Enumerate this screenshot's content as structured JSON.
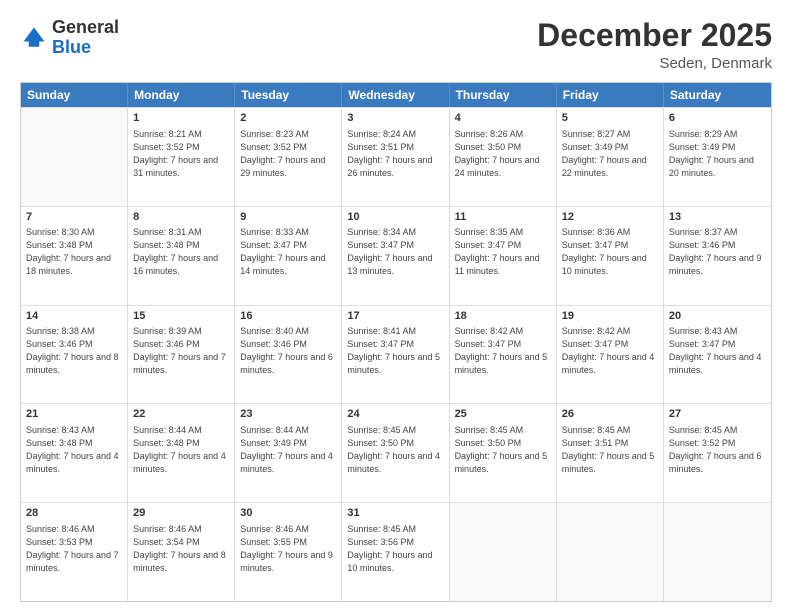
{
  "logo": {
    "general": "General",
    "blue": "Blue"
  },
  "header": {
    "title": "December 2025",
    "subtitle": "Seden, Denmark"
  },
  "calendar": {
    "days": [
      "Sunday",
      "Monday",
      "Tuesday",
      "Wednesday",
      "Thursday",
      "Friday",
      "Saturday"
    ],
    "rows": [
      [
        {
          "day": "",
          "empty": true
        },
        {
          "day": "1",
          "sunrise": "8:21 AM",
          "sunset": "3:52 PM",
          "daylight": "7 hours and 31 minutes."
        },
        {
          "day": "2",
          "sunrise": "8:23 AM",
          "sunset": "3:52 PM",
          "daylight": "7 hours and 29 minutes."
        },
        {
          "day": "3",
          "sunrise": "8:24 AM",
          "sunset": "3:51 PM",
          "daylight": "7 hours and 26 minutes."
        },
        {
          "day": "4",
          "sunrise": "8:26 AM",
          "sunset": "3:50 PM",
          "daylight": "7 hours and 24 minutes."
        },
        {
          "day": "5",
          "sunrise": "8:27 AM",
          "sunset": "3:49 PM",
          "daylight": "7 hours and 22 minutes."
        },
        {
          "day": "6",
          "sunrise": "8:29 AM",
          "sunset": "3:49 PM",
          "daylight": "7 hours and 20 minutes."
        }
      ],
      [
        {
          "day": "7",
          "sunrise": "8:30 AM",
          "sunset": "3:48 PM",
          "daylight": "7 hours and 18 minutes."
        },
        {
          "day": "8",
          "sunrise": "8:31 AM",
          "sunset": "3:48 PM",
          "daylight": "7 hours and 16 minutes."
        },
        {
          "day": "9",
          "sunrise": "8:33 AM",
          "sunset": "3:47 PM",
          "daylight": "7 hours and 14 minutes."
        },
        {
          "day": "10",
          "sunrise": "8:34 AM",
          "sunset": "3:47 PM",
          "daylight": "7 hours and 13 minutes."
        },
        {
          "day": "11",
          "sunrise": "8:35 AM",
          "sunset": "3:47 PM",
          "daylight": "7 hours and 11 minutes."
        },
        {
          "day": "12",
          "sunrise": "8:36 AM",
          "sunset": "3:47 PM",
          "daylight": "7 hours and 10 minutes."
        },
        {
          "day": "13",
          "sunrise": "8:37 AM",
          "sunset": "3:46 PM",
          "daylight": "7 hours and 9 minutes."
        }
      ],
      [
        {
          "day": "14",
          "sunrise": "8:38 AM",
          "sunset": "3:46 PM",
          "daylight": "7 hours and 8 minutes."
        },
        {
          "day": "15",
          "sunrise": "8:39 AM",
          "sunset": "3:46 PM",
          "daylight": "7 hours and 7 minutes."
        },
        {
          "day": "16",
          "sunrise": "8:40 AM",
          "sunset": "3:46 PM",
          "daylight": "7 hours and 6 minutes."
        },
        {
          "day": "17",
          "sunrise": "8:41 AM",
          "sunset": "3:47 PM",
          "daylight": "7 hours and 5 minutes."
        },
        {
          "day": "18",
          "sunrise": "8:42 AM",
          "sunset": "3:47 PM",
          "daylight": "7 hours and 5 minutes."
        },
        {
          "day": "19",
          "sunrise": "8:42 AM",
          "sunset": "3:47 PM",
          "daylight": "7 hours and 4 minutes."
        },
        {
          "day": "20",
          "sunrise": "8:43 AM",
          "sunset": "3:47 PM",
          "daylight": "7 hours and 4 minutes."
        }
      ],
      [
        {
          "day": "21",
          "sunrise": "8:43 AM",
          "sunset": "3:48 PM",
          "daylight": "7 hours and 4 minutes."
        },
        {
          "day": "22",
          "sunrise": "8:44 AM",
          "sunset": "3:48 PM",
          "daylight": "7 hours and 4 minutes."
        },
        {
          "day": "23",
          "sunrise": "8:44 AM",
          "sunset": "3:49 PM",
          "daylight": "7 hours and 4 minutes."
        },
        {
          "day": "24",
          "sunrise": "8:45 AM",
          "sunset": "3:50 PM",
          "daylight": "7 hours and 4 minutes."
        },
        {
          "day": "25",
          "sunrise": "8:45 AM",
          "sunset": "3:50 PM",
          "daylight": "7 hours and 5 minutes."
        },
        {
          "day": "26",
          "sunrise": "8:45 AM",
          "sunset": "3:51 PM",
          "daylight": "7 hours and 5 minutes."
        },
        {
          "day": "27",
          "sunrise": "8:45 AM",
          "sunset": "3:52 PM",
          "daylight": "7 hours and 6 minutes."
        }
      ],
      [
        {
          "day": "28",
          "sunrise": "8:46 AM",
          "sunset": "3:53 PM",
          "daylight": "7 hours and 7 minutes."
        },
        {
          "day": "29",
          "sunrise": "8:46 AM",
          "sunset": "3:54 PM",
          "daylight": "7 hours and 8 minutes."
        },
        {
          "day": "30",
          "sunrise": "8:46 AM",
          "sunset": "3:55 PM",
          "daylight": "7 hours and 9 minutes."
        },
        {
          "day": "31",
          "sunrise": "8:45 AM",
          "sunset": "3:56 PM",
          "daylight": "7 hours and 10 minutes."
        },
        {
          "day": "",
          "empty": true
        },
        {
          "day": "",
          "empty": true
        },
        {
          "day": "",
          "empty": true
        }
      ]
    ]
  }
}
